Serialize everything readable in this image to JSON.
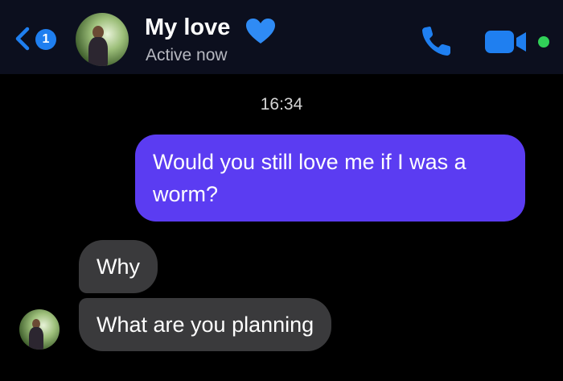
{
  "header": {
    "unread_count": "1",
    "contact_name": "My love",
    "status": "Active now",
    "back_icon": "chevron-left-icon",
    "heart_icon": "blue-heart-icon",
    "call_icon": "phone-icon",
    "video_icon": "video-camera-icon",
    "accent_color": "#1f7ff0",
    "online_color": "#31d158"
  },
  "conversation": {
    "timestamp": "16:34",
    "messages": [
      {
        "direction": "outgoing",
        "text": "Would you still love me if I was a worm?",
        "color": "#5b3cf2"
      },
      {
        "direction": "incoming",
        "text": "Why",
        "color": "#3a3a3c"
      },
      {
        "direction": "incoming",
        "text": "What are you planning",
        "color": "#3a3a3c"
      }
    ]
  }
}
